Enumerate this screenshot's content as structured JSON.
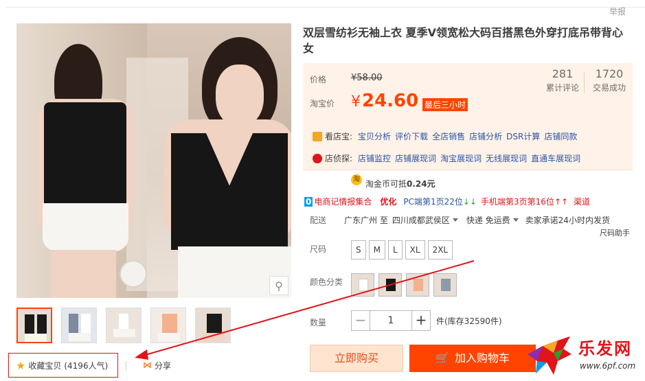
{
  "header": {
    "report": "举报"
  },
  "product": {
    "title": "双层雪纺衫无袖上衣 夏季V领宽松大码百搭黑色外穿打底吊带背心女"
  },
  "price": {
    "label": "价格",
    "original": "¥58.00",
    "taobao_label": "淘宝价",
    "currency": "¥",
    "current": "24.60",
    "badge": "最后三小时",
    "reviews_count": "281",
    "reviews_label": "累计评论",
    "sales_count": "1720",
    "sales_label": "交易成功"
  },
  "tools": {
    "kandian": {
      "name": "看店宝:",
      "links": [
        "宝贝分析",
        "评价下载",
        "全店销售",
        "店铺分析",
        "DSR计算",
        "店铺同款"
      ]
    },
    "zhentan": {
      "name": "店侦探:",
      "links": [
        "店铺监控",
        "店铺展现词",
        "淘宝展现词",
        "无线展现词",
        "直通车展现词"
      ]
    }
  },
  "coin": {
    "icon": "淘",
    "text_prefix": "淘金币可抵",
    "amount": "0.24元"
  },
  "plugin": {
    "badge": "0",
    "name": "电商记情报集合",
    "optimize": "优化",
    "pc": "PC端第1页22位",
    "down_arrows": "↓↓",
    "mobile": "手机端第3页第16位",
    "up_arrows": "↑↑",
    "channel": "渠道"
  },
  "shipping": {
    "label": "配送",
    "from": "广东广州 至",
    "to": "四川成都武侯区",
    "method": "快递 免运费",
    "promise": "卖家承诺24小时内发货"
  },
  "size_helper": "尺码助手",
  "options": {
    "size_label": "尺码",
    "sizes": [
      "S",
      "M",
      "L",
      "XL",
      "2XL"
    ],
    "color_label": "颜色分类"
  },
  "quantity": {
    "label": "数量",
    "minus": "−",
    "value": "1",
    "plus": "+",
    "stock": "件(库存32590件)"
  },
  "actions": {
    "buy_now": "立即购买",
    "add_cart": "加入购物车"
  },
  "favorite": {
    "label": "收藏宝贝",
    "count": "(4196人气)"
  },
  "share": {
    "label": "分享"
  },
  "watermark": {
    "name": "乐发网",
    "url": "www.6pf.com"
  },
  "colors": {
    "accent": "#ff4400",
    "link": "#2953a6",
    "price_bg": "#fff2e8",
    "annotation": "#e0141a"
  }
}
